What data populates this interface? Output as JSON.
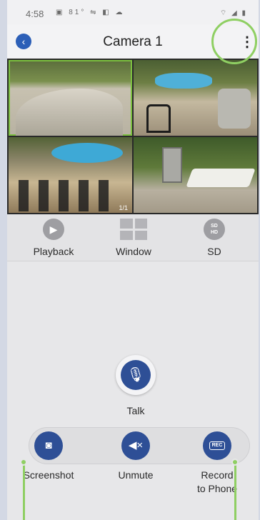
{
  "status_bar": {
    "time": "4:58",
    "left_icons": "▣ 81° ⇋ ◧ ☁",
    "right_icons": "⌔ ◢ ▮"
  },
  "nav": {
    "back_icon": "‹",
    "title": "Camera 1",
    "more_icon": "⋮"
  },
  "camera_grid": {
    "page_indicator": "1/1"
  },
  "features": [
    {
      "label": "Playback",
      "icon": "play-icon",
      "glyph": "▶"
    },
    {
      "label": "Window",
      "icon": "grid-icon"
    },
    {
      "label": "SD",
      "icon": "sd-hd-icon",
      "glyph_top": "SD",
      "glyph_bottom": "HD"
    }
  ],
  "talk": {
    "label": "Talk",
    "glyph": "🎙"
  },
  "actions": [
    {
      "label": "Screenshot",
      "icon": "camera-icon",
      "glyph": "◙"
    },
    {
      "label": "Unmute",
      "icon": "speaker-muted-icon",
      "glyph": "◀×"
    },
    {
      "label_line1": "Record",
      "label_line2": "to Phone",
      "icon": "record-icon",
      "glyph": "REC"
    }
  ],
  "colors": {
    "accent": "#2e4f96",
    "highlight": "#8fcf63",
    "back_button": "#2c5fb7"
  }
}
